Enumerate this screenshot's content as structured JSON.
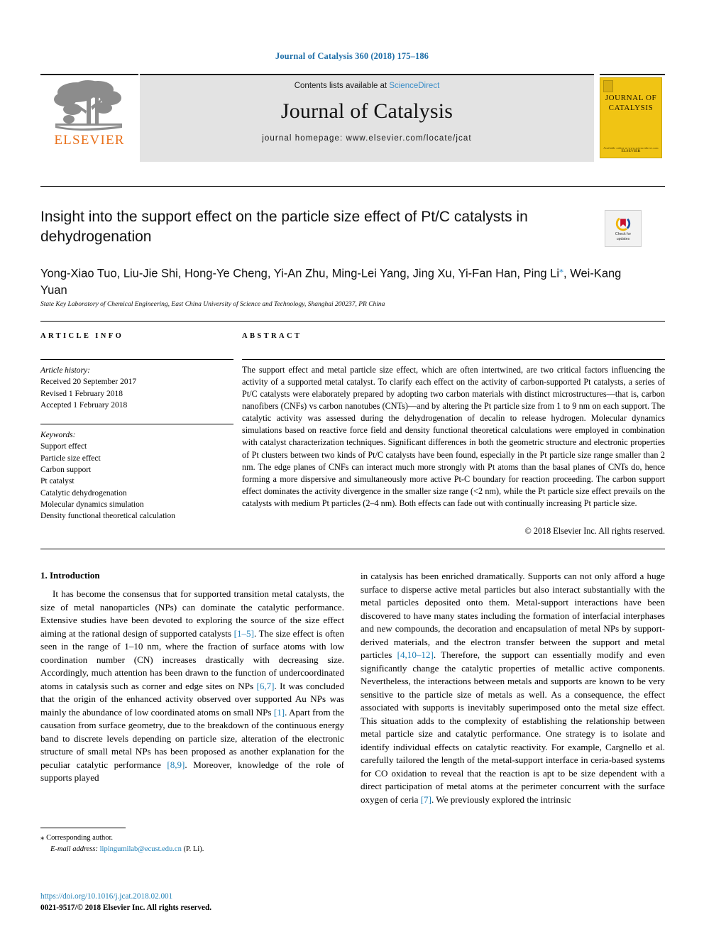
{
  "running_head": "Journal of Catalysis 360 (2018) 175–186",
  "masthead": {
    "publisher": "ELSEVIER",
    "contents_prefix": "Contents lists available at ",
    "contents_link": "ScienceDirect",
    "journal_name": "Journal of Catalysis",
    "homepage": "journal homepage: www.elsevier.com/locate/jcat",
    "cover": {
      "line1": "JOURNAL OF",
      "line2": "CATALYSIS",
      "footer1": "Available online at www.sciencedirect.com",
      "footer2": "ELSEVIER"
    }
  },
  "article": {
    "title": "Insight into the support effect on the particle size effect of Pt/C catalysts in dehydrogenation",
    "crossmark": {
      "line1": "Check for",
      "line2": "updates"
    },
    "authors": "Yong-Xiao Tuo, Liu-Jie Shi, Hong-Ye Cheng, Yi-An Zhu, Ming-Lei Yang, Jing Xu, Yi-Fan Han, Ping Li",
    "authors_cont": ", Wei-Kang Yuan",
    "corresponding_marker": "⁎",
    "affiliation": "State Key Laboratory of Chemical Engineering, East China University of Science and Technology, Shanghai 200237, PR China"
  },
  "info": {
    "label": "ARTICLE INFO",
    "history_header": "Article history:",
    "history": [
      "Received 20 September 2017",
      "Revised 1 February 2018",
      "Accepted 1 February 2018"
    ],
    "keywords_header": "Keywords:",
    "keywords": [
      "Support effect",
      "Particle size effect",
      "Carbon support",
      "Pt catalyst",
      "Catalytic dehydrogenation",
      "Molecular dynamics simulation",
      "Density functional theoretical calculation"
    ]
  },
  "abstract": {
    "label": "ABSTRACT",
    "text": "The support effect and metal particle size effect, which are often intertwined, are two critical factors influencing the activity of a supported metal catalyst. To clarify each effect on the activity of carbon-supported Pt catalysts, a series of Pt/C catalysts were elaborately prepared by adopting two carbon materials with distinct microstructures—that is, carbon nanofibers (CNFs) vs carbon nanotubes (CNTs)—and by altering the Pt particle size from 1 to 9 nm on each support. The catalytic activity was assessed during the dehydrogenation of decalin to release hydrogen. Molecular dynamics simulations based on reactive force field and density functional theoretical calculations were employed in combination with catalyst characterization techniques. Significant differences in both the geometric structure and electronic properties of Pt clusters between two kinds of Pt/C catalysts have been found, especially in the Pt particle size range smaller than 2 nm. The edge planes of CNFs can interact much more strongly with Pt atoms than the basal planes of CNTs do, hence forming a more dispersive and simultaneously more active Pt-C boundary for reaction proceeding. The carbon support effect dominates the activity divergence in the smaller size range (<2 nm), while the Pt particle size effect prevails on the catalysts with medium Pt particles (2–4 nm). Both effects can fade out with continually increasing Pt particle size.",
    "copyright": "© 2018 Elsevier Inc. All rights reserved."
  },
  "body": {
    "section_title": "1. Introduction",
    "left_para_1a": "It has become the consensus that for supported transition metal catalysts, the size of metal nanoparticles (NPs) can dominate the catalytic performance. Extensive studies have been devoted to exploring the source of the size effect aiming at the rational design of supported catalysts ",
    "ref_1_5": "[1–5]",
    "left_para_1b": ". The size effect is often seen in the range of 1–10 nm, where the fraction of surface atoms with low coordination number (CN) increases drastically with decreasing size. Accordingly, much attention has been drawn to the function of undercoordinated atoms in catalysis such as corner and edge sites on NPs ",
    "ref_6_7": "[6,7]",
    "left_para_1c": ". It was concluded that the origin of the enhanced activity observed over supported Au NPs was mainly the abundance of low coordinated atoms on small NPs ",
    "ref_1": "[1]",
    "left_para_1d": ". Apart from the causation from surface geometry, due to the breakdown of the continuous energy band to discrete levels depending on particle size, alteration of the electronic structure of small metal NPs has been proposed as another explanation for the peculiar catalytic performance ",
    "ref_8_9": "[8,9]",
    "left_para_1e": ". Moreover, knowledge of the role of supports played",
    "right_para_1a": "in catalysis has been enriched dramatically. Supports can not only afford a huge surface to disperse active metal particles but also interact substantially with the metal particles deposited onto them. Metal-support interactions have been discovered to have many states including the formation of interfacial interphases and new compounds, the decoration and encapsulation of metal NPs by support-derived materials, and the electron transfer between the support and metal particles ",
    "ref_4_10_12": "[4,10–12]",
    "right_para_1b": ". Therefore, the support can essentially modify and even significantly change the catalytic properties of metallic active components. Nevertheless, the interactions between metals and supports are known to be very sensitive to the particle size of metals as well. As a consequence, the effect associated with supports is inevitably superimposed onto the metal size effect. This situation adds to the complexity of establishing the relationship between metal particle size and catalytic performance. One strategy is to isolate and identify individual effects on catalytic reactivity. For example, Cargnello et al. carefully tailored the length of the metal-support interface in ceria-based systems for CO oxidation to reveal that the reaction is apt to be size dependent with a direct participation of metal atoms at the perimeter concurrent with the surface oxygen of ceria ",
    "ref_7": "[7]",
    "right_para_1c": ". We previously explored the intrinsic"
  },
  "footer": {
    "corresponding_star": "⁎",
    "corresponding_label": "Corresponding author.",
    "email_label": "E-mail address:",
    "email": "lipingumilab@ecust.edu.cn",
    "email_suffix": "(P. Li).",
    "doi": "https://doi.org/10.1016/j.jcat.2018.02.001",
    "issn_line": "0021-9517/© 2018 Elsevier Inc. All rights reserved."
  },
  "colors": {
    "link": "#1f7fb5",
    "running_head": "#1f6fa8",
    "elsevier_orange": "#E9711C",
    "band_gray": "#e3e3e3",
    "cover_yellow": "#f0c414"
  }
}
